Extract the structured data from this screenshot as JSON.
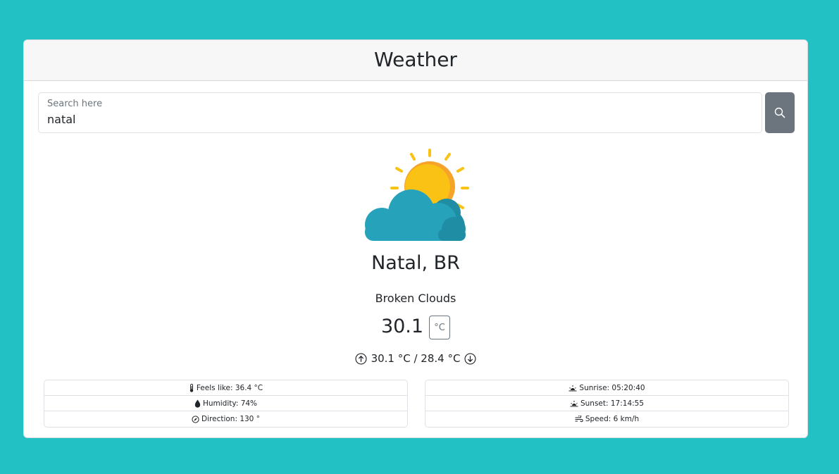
{
  "app": {
    "title": "Weather"
  },
  "search": {
    "label": "Search here",
    "value": "natal",
    "button_icon": "search-icon"
  },
  "weather": {
    "icon": "partly-cloudy-icon",
    "city": "Natal, BR",
    "description": "Broken Clouds",
    "temperature": "30.1",
    "unit": "°C",
    "max_min": "30.1 °C / 28.4 °C"
  },
  "details_left": [
    {
      "icon": "thermometer-icon",
      "text": "Feels like: 36.4 °C"
    },
    {
      "icon": "droplet-icon",
      "text": "Humidity: 74%"
    },
    {
      "icon": "compass-icon",
      "text": "Direction: 130 °"
    }
  ],
  "details_right": [
    {
      "icon": "sunrise-icon",
      "text": "Sunrise: 05:20:40"
    },
    {
      "icon": "sunset-icon",
      "text": "Sunset: 17:14:55"
    },
    {
      "icon": "wind-icon",
      "text": "Speed: 6 km/h"
    }
  ],
  "colors": {
    "background": "#22c1c3",
    "button": "#6c757d",
    "sun": "#f9c215",
    "cloud": "#27a2bb"
  }
}
